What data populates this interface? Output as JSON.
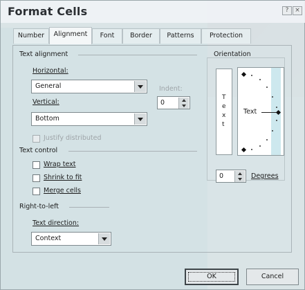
{
  "window": {
    "title": "Format Cells",
    "help_glyph": "?",
    "close_glyph": "×"
  },
  "tabs": [
    {
      "label": "Number"
    },
    {
      "label": "Alignment",
      "active": true
    },
    {
      "label": "Font"
    },
    {
      "label": "Border"
    },
    {
      "label": "Patterns"
    },
    {
      "label": "Protection"
    }
  ],
  "text_alignment": {
    "group_label": "Text alignment",
    "horizontal_label": "Horizontal:",
    "horizontal_value": "General",
    "vertical_label": "Vertical:",
    "vertical_value": "Bottom",
    "indent_label": "Indent:",
    "indent_value": "0",
    "justify_distributed_label": "Justify distributed",
    "justify_distributed_enabled": false
  },
  "text_control": {
    "group_label": "Text control",
    "wrap_text_label": "Wrap text",
    "wrap_text_checked": false,
    "shrink_to_fit_label": "Shrink to fit",
    "shrink_to_fit_checked": false,
    "merge_cells_label": "Merge cells",
    "merge_cells_checked": false
  },
  "right_to_left": {
    "group_label": "Right-to-left",
    "text_direction_label": "Text direction:",
    "text_direction_value": "Context"
  },
  "orientation": {
    "group_label": "Orientation",
    "vertical_text": [
      "T",
      "e",
      "x",
      "t"
    ],
    "dial_text": "Text",
    "degrees_value": "0",
    "degrees_label": "Degrees"
  },
  "buttons": {
    "ok": "OK",
    "cancel": "Cancel"
  },
  "colors": {
    "watermark_teal": "#c5e6ec",
    "watermark_pink": "#f3dde6",
    "dialog_face": "#d4e0e2"
  }
}
